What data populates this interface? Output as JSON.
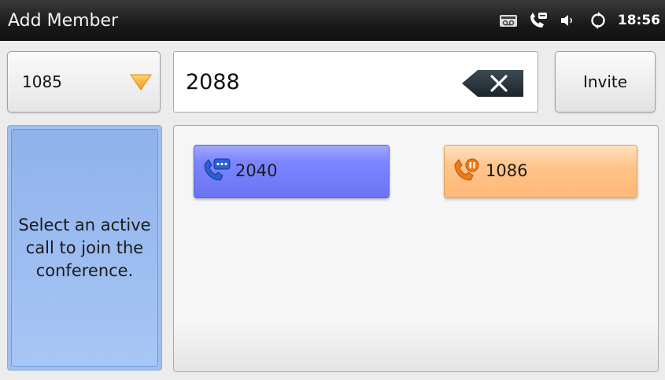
{
  "titlebar": {
    "title": "Add Member",
    "time": "18:56",
    "icons": [
      "voicemail-icon",
      "phone-status-icon",
      "volume-icon",
      "sync-icon"
    ]
  },
  "account_select": {
    "value": "1085",
    "arrow_color": "#f5a623"
  },
  "number_field": {
    "value": "2088"
  },
  "invite_button": {
    "label": "Invite"
  },
  "hint": {
    "text": "Select an active call to join the conference."
  },
  "calls": [
    {
      "number": "2040",
      "state_color": "#7d86ff",
      "icon": "phone-chat-icon"
    },
    {
      "number": "1086",
      "state_color": "#ffc48a",
      "icon": "phone-hold-icon"
    }
  ],
  "colors": {
    "hint_panel": "#9fbff0",
    "active_call": "#7d86ff",
    "held_call": "#ffb877"
  }
}
